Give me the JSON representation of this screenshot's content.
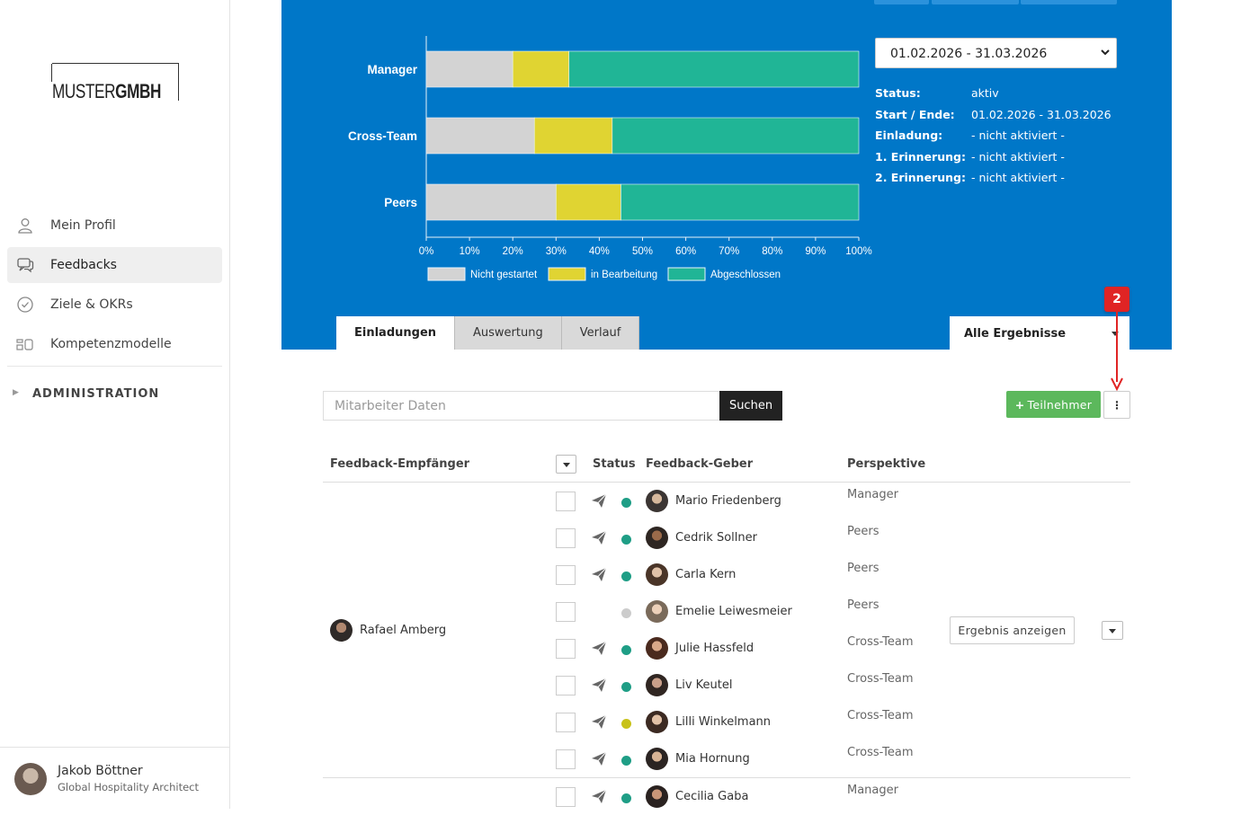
{
  "sidebar": {
    "logo": {
      "light": "MUSTER",
      "bold": "GMBH"
    },
    "nav": [
      {
        "label": "Mein Profil",
        "icon": "user-icon",
        "active": false
      },
      {
        "label": "Feedbacks",
        "icon": "chat-icon",
        "active": true
      },
      {
        "label": "Ziele & OKRs",
        "icon": "check-circle-icon",
        "active": false
      },
      {
        "label": "Kompetenzmodelle",
        "icon": "model-icon",
        "active": false
      }
    ],
    "admin_label": "ADMINISTRATION",
    "user": {
      "name": "Jakob Böttner",
      "role": "Global Hospitality Architect"
    }
  },
  "colors": {
    "header_bg": "#0077c8",
    "not_started": "#d3d3d3",
    "in_progress": "#e0d432",
    "done": "#20b596",
    "status_green": "#1f9e86",
    "status_yellow": "#c8c21a",
    "status_grey": "#cccccc",
    "add_button": "#5cb85c",
    "annotation": "#e02424"
  },
  "chart_data": {
    "type": "bar",
    "orientation": "horizontal",
    "stacked": true,
    "categories": [
      "Manager",
      "Cross-Team",
      "Peers"
    ],
    "series": [
      {
        "name": "Nicht gestartet",
        "values": [
          20,
          25,
          30
        ],
        "color": "#d3d3d3"
      },
      {
        "name": "in Bearbeitung",
        "values": [
          13,
          18,
          15
        ],
        "color": "#e0d432"
      },
      {
        "name": "Abgeschlossen",
        "values": [
          67,
          57,
          55
        ],
        "color": "#20b596"
      }
    ],
    "xlim": [
      0,
      100
    ],
    "xticks": [
      "0%",
      "10%",
      "20%",
      "30%",
      "40%",
      "50%",
      "60%",
      "70%",
      "80%",
      "90%",
      "100%"
    ],
    "legend_position": "bottom",
    "grid": false
  },
  "period": {
    "selected": "01.02.2026 - 31.03.2026",
    "info": [
      {
        "label": "Status:",
        "value": "aktiv"
      },
      {
        "label": "Start / Ende:",
        "value": "01.02.2026 - 31.03.2026"
      },
      {
        "label": "Einladung:",
        "value": "- nicht aktiviert -"
      },
      {
        "label": "1. Erinnerung:",
        "value": "- nicht aktiviert -"
      },
      {
        "label": "2. Erinnerung:",
        "value": "- nicht aktiviert -"
      }
    ]
  },
  "tabs": [
    {
      "label": "Einladungen",
      "active": true
    },
    {
      "label": "Auswertung",
      "active": false
    },
    {
      "label": "Verlauf",
      "active": false
    }
  ],
  "results_filter": "Alle Ergebnisse",
  "annotation": {
    "number": "2"
  },
  "search": {
    "placeholder": "Mitarbeiter Daten",
    "value": "",
    "button": "Suchen"
  },
  "add_button": {
    "label": "Teilnehmer"
  },
  "table": {
    "headers": {
      "recipient": "Feedback-Empfänger",
      "status": "Status",
      "giver": "Feedback-Geber",
      "perspective": "Perspektive"
    },
    "recipient": {
      "name": "Rafael Amberg"
    },
    "result_button": "Ergebnis anzeigen",
    "givers": [
      {
        "name": "Mario Friedenberg",
        "perspective": "Manager",
        "status": "green",
        "sent": true
      },
      {
        "name": "Cedrik Sollner",
        "perspective": "Peers",
        "status": "green",
        "sent": true
      },
      {
        "name": "Carla Kern",
        "perspective": "Peers",
        "status": "green",
        "sent": true
      },
      {
        "name": "Emelie Leiwesmeier",
        "perspective": "Peers",
        "status": "grey",
        "sent": false
      },
      {
        "name": "Julie Hassfeld",
        "perspective": "Cross-Team",
        "status": "green",
        "sent": true
      },
      {
        "name": "Liv Keutel",
        "perspective": "Cross-Team",
        "status": "green",
        "sent": true
      },
      {
        "name": "Lilli Winkelmann",
        "perspective": "Cross-Team",
        "status": "yellow",
        "sent": true
      },
      {
        "name": "Mia Hornung",
        "perspective": "Cross-Team",
        "status": "green",
        "sent": true
      }
    ],
    "next_giver": {
      "name": "Cecilia Gaba",
      "perspective": "Manager",
      "status": "green",
      "sent": true
    }
  }
}
